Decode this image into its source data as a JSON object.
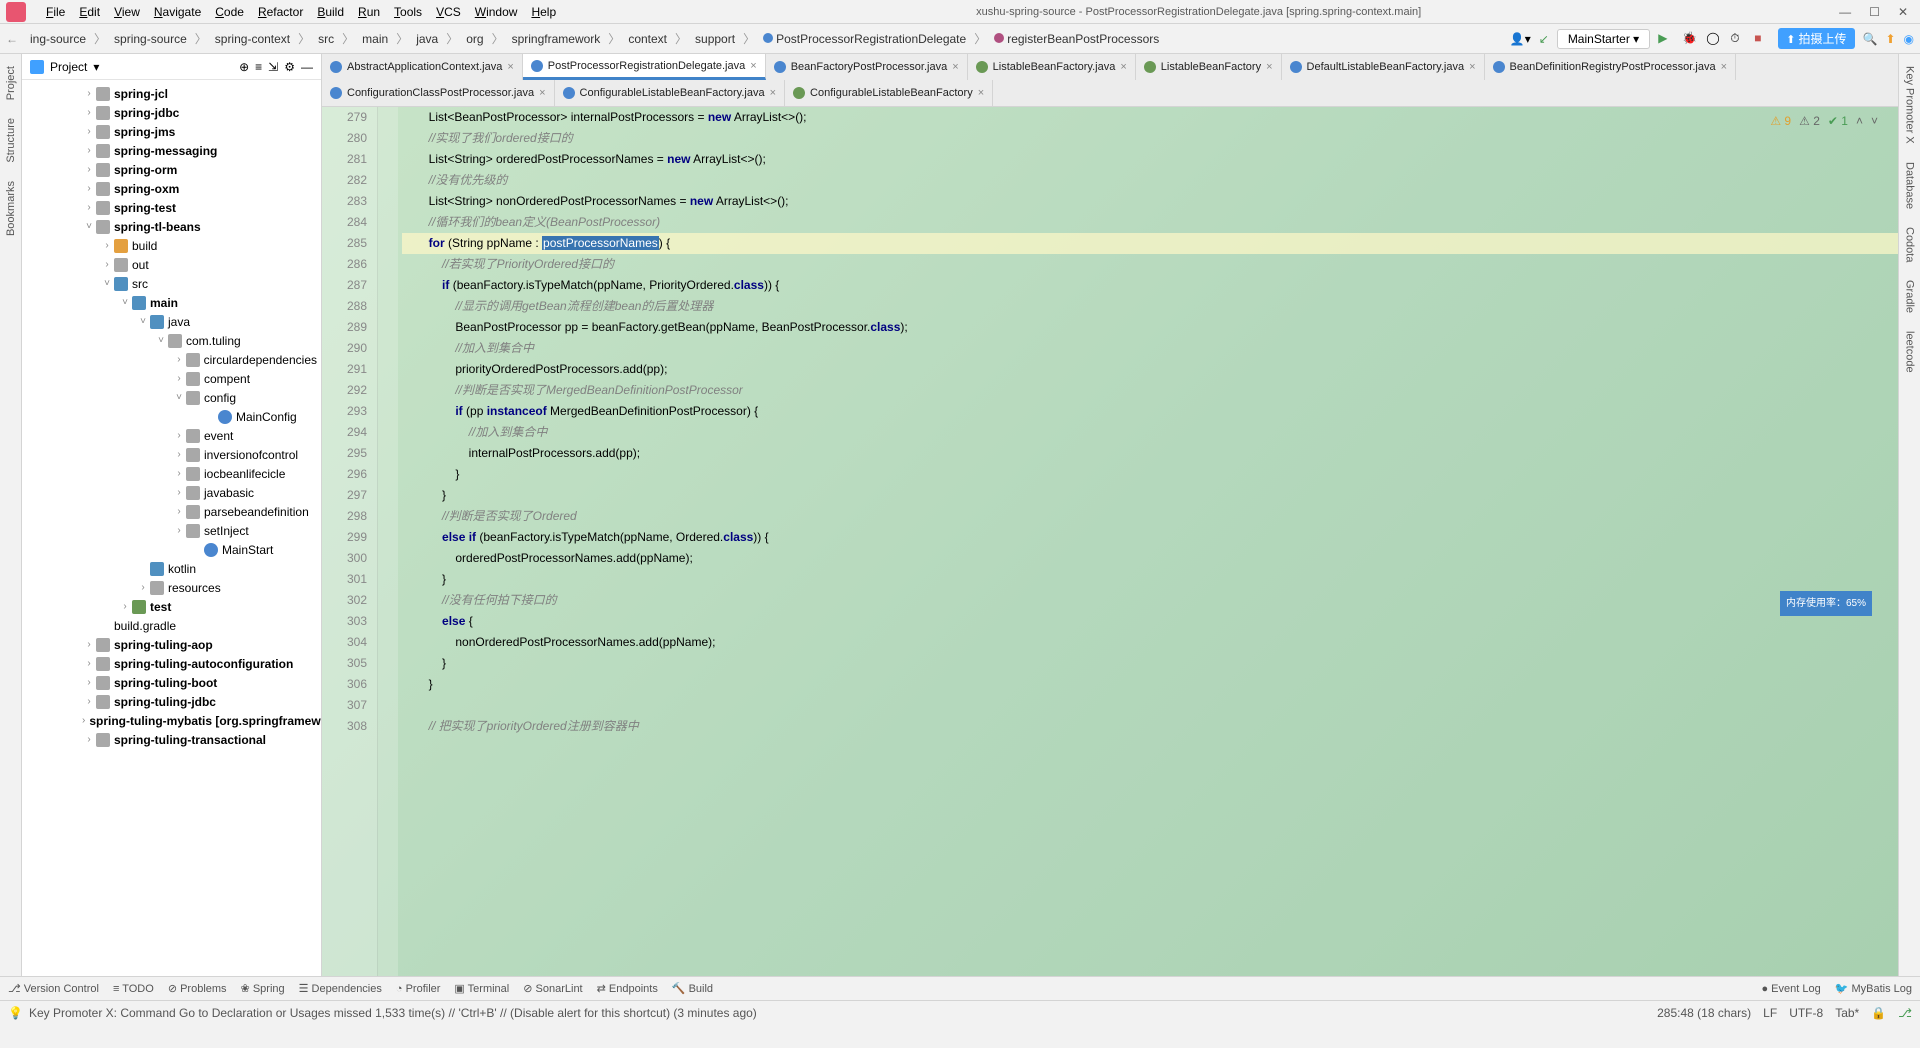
{
  "window": {
    "title": "xushu-spring-source - PostProcessorRegistrationDelegate.java [spring.spring-context.main]"
  },
  "menu": [
    "File",
    "Edit",
    "View",
    "Navigate",
    "Code",
    "Refactor",
    "Build",
    "Run",
    "Tools",
    "VCS",
    "Window",
    "Help"
  ],
  "breadcrumb": [
    "ing-source",
    "spring-source",
    "spring-context",
    "src",
    "main",
    "java",
    "org",
    "springframework",
    "context",
    "support",
    "PostProcessorRegistrationDelegate",
    "registerBeanPostProcessors"
  ],
  "runConfig": "MainStarter",
  "uploadBadge": "拍摄上传",
  "project": {
    "label": "Project"
  },
  "tree": [
    {
      "ind": 60,
      "exp": ">",
      "ico": "dir",
      "lbl": "spring-jcl",
      "b": 1
    },
    {
      "ind": 60,
      "exp": ">",
      "ico": "dir",
      "lbl": "spring-jdbc",
      "b": 1
    },
    {
      "ind": 60,
      "exp": ">",
      "ico": "dir",
      "lbl": "spring-jms",
      "b": 1
    },
    {
      "ind": 60,
      "exp": ">",
      "ico": "dir",
      "lbl": "spring-messaging",
      "b": 1
    },
    {
      "ind": 60,
      "exp": ">",
      "ico": "dir",
      "lbl": "spring-orm",
      "b": 1
    },
    {
      "ind": 60,
      "exp": ">",
      "ico": "dir",
      "lbl": "spring-oxm",
      "b": 1
    },
    {
      "ind": 60,
      "exp": ">",
      "ico": "dir",
      "lbl": "spring-test",
      "b": 1
    },
    {
      "ind": 60,
      "exp": "v",
      "ico": "dir",
      "lbl": "spring-tl-beans",
      "b": 1
    },
    {
      "ind": 78,
      "exp": ">",
      "ico": "dir-o",
      "lbl": "build"
    },
    {
      "ind": 78,
      "exp": ">",
      "ico": "dir",
      "lbl": "out"
    },
    {
      "ind": 78,
      "exp": "v",
      "ico": "dir-b",
      "lbl": "src"
    },
    {
      "ind": 96,
      "exp": "v",
      "ico": "dir-b",
      "lbl": "main",
      "b": 1
    },
    {
      "ind": 114,
      "exp": "v",
      "ico": "dir-b",
      "lbl": "java"
    },
    {
      "ind": 132,
      "exp": "v",
      "ico": "dir",
      "lbl": "com.tuling"
    },
    {
      "ind": 150,
      "exp": ">",
      "ico": "dir",
      "lbl": "circulardependencies"
    },
    {
      "ind": 150,
      "exp": ">",
      "ico": "dir",
      "lbl": "compent"
    },
    {
      "ind": 150,
      "exp": "v",
      "ico": "dir",
      "lbl": "config"
    },
    {
      "ind": 182,
      "exp": "",
      "ico": "cfile",
      "lbl": "MainConfig"
    },
    {
      "ind": 150,
      "exp": ">",
      "ico": "dir",
      "lbl": "event"
    },
    {
      "ind": 150,
      "exp": ">",
      "ico": "dir",
      "lbl": "inversionofcontrol"
    },
    {
      "ind": 150,
      "exp": ">",
      "ico": "dir",
      "lbl": "iocbeanlifecicle"
    },
    {
      "ind": 150,
      "exp": ">",
      "ico": "dir",
      "lbl": "javabasic"
    },
    {
      "ind": 150,
      "exp": ">",
      "ico": "dir",
      "lbl": "parsebeandefinition"
    },
    {
      "ind": 150,
      "exp": ">",
      "ico": "dir",
      "lbl": "setInject"
    },
    {
      "ind": 168,
      "exp": "",
      "ico": "cfile",
      "lbl": "MainStart"
    },
    {
      "ind": 114,
      "exp": "",
      "ico": "dir-b",
      "lbl": "kotlin"
    },
    {
      "ind": 114,
      "exp": ">",
      "ico": "dir",
      "lbl": "resources"
    },
    {
      "ind": 96,
      "exp": ">",
      "ico": "dir-g",
      "lbl": "test",
      "b": 1
    },
    {
      "ind": 78,
      "exp": "",
      "ico": "",
      "lbl": "build.gradle"
    },
    {
      "ind": 60,
      "exp": ">",
      "ico": "dir",
      "lbl": "spring-tuling-aop",
      "b": 1
    },
    {
      "ind": 60,
      "exp": ">",
      "ico": "dir",
      "lbl": "spring-tuling-autoconfiguration",
      "b": 1
    },
    {
      "ind": 60,
      "exp": ">",
      "ico": "dir",
      "lbl": "spring-tuling-boot",
      "b": 1
    },
    {
      "ind": 60,
      "exp": ">",
      "ico": "dir",
      "lbl": "spring-tuling-jdbc",
      "b": 1
    },
    {
      "ind": 60,
      "exp": ">",
      "ico": "dir",
      "lbl": "spring-tuling-mybatis [org.springframewo",
      "b": 1
    },
    {
      "ind": 60,
      "exp": ">",
      "ico": "dir",
      "lbl": "spring-tuling-transactional",
      "b": 1
    }
  ],
  "tabs": [
    {
      "ico": "ti-c",
      "lbl": "AbstractApplicationContext.java"
    },
    {
      "ico": "ti-c",
      "lbl": "PostProcessorRegistrationDelegate.java",
      "active": 1
    },
    {
      "ico": "ti-c",
      "lbl": "BeanFactoryPostProcessor.java"
    },
    {
      "ico": "ti-i",
      "lbl": "ListableBeanFactory.java"
    },
    {
      "ico": "ti-i",
      "lbl": "ListableBeanFactory"
    },
    {
      "ico": "ti-c",
      "lbl": "DefaultListableBeanFactory.java"
    },
    {
      "ico": "ti-c",
      "lbl": "BeanDefinitionRegistryPostProcessor.java"
    },
    {
      "ico": "ti-c",
      "lbl": "ConfigurationClassPostProcessor.java"
    },
    {
      "ico": "ti-c",
      "lbl": "ConfigurableListableBeanFactory.java"
    },
    {
      "ico": "ti-i",
      "lbl": "ConfigurableListableBeanFactory"
    }
  ],
  "lines": {
    "start": 279,
    "end": 308
  },
  "inspections": {
    "warn": "9",
    "weak": "2",
    "ok": "1"
  },
  "memind": "内存使用率：65%",
  "bottomTabs": [
    "Version Control",
    "TODO",
    "Problems",
    "Spring",
    "Dependencies",
    "Profiler",
    "Terminal",
    "SonarLint",
    "Endpoints",
    "Build"
  ],
  "bottomRight": [
    "Event Log",
    "MyBatis Log"
  ],
  "status": {
    "msg": "Key Promoter X: Command Go to Declaration or Usages missed 1,533 time(s) // 'Ctrl+B' // (Disable alert for this shortcut) (3 minutes ago)",
    "pos": "285:48 (18 chars)",
    "le": "LF",
    "enc": "UTF-8",
    "ind": "Tab*"
  },
  "leftTabs": [
    "Project",
    "Structure",
    "Bookmarks"
  ],
  "rightTabs": [
    "Key Promoter X",
    "Database",
    "Codota",
    "Gradle",
    "leetcode"
  ]
}
